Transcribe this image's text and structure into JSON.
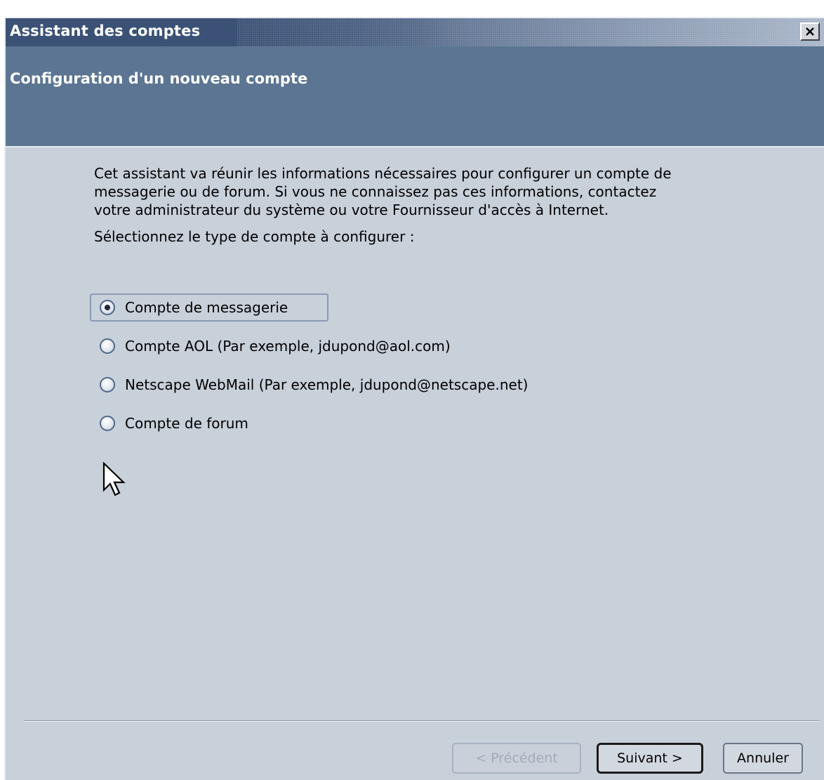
{
  "window": {
    "title": "Assistant des comptes",
    "close_symbol": "×"
  },
  "header": {
    "title": "Configuration d'un nouveau compte"
  },
  "content": {
    "intro_line1": "Cet assistant va réunir les informations nécessaires pour configurer un compte de",
    "intro_line2": "messagerie ou de forum. Si vous ne connaissez pas ces informations, contactez",
    "intro_line3": "votre administrateur du système ou votre Fournisseur d'accès à Internet.",
    "select_label": "Sélectionnez le type de compte à configurer :"
  },
  "account_types": [
    {
      "label": "Compte de messagerie",
      "selected": true
    },
    {
      "label": "Compte AOL (Par exemple, jdupond@aol.com)",
      "selected": false
    },
    {
      "label": "Netscape WebMail (Par exemple, jdupond@netscape.net)",
      "selected": false
    },
    {
      "label": "Compte de forum",
      "selected": false
    }
  ],
  "buttons": {
    "previous": "< Précédent",
    "next": "Suivant >",
    "cancel": "Annuler"
  },
  "icons": {
    "close": "close-icon",
    "cursor": "mouse-pointer-icon"
  },
  "colors": {
    "titlebar": "#3b5276",
    "header_band": "#5b7592",
    "body_bg": "#c8d0da"
  }
}
